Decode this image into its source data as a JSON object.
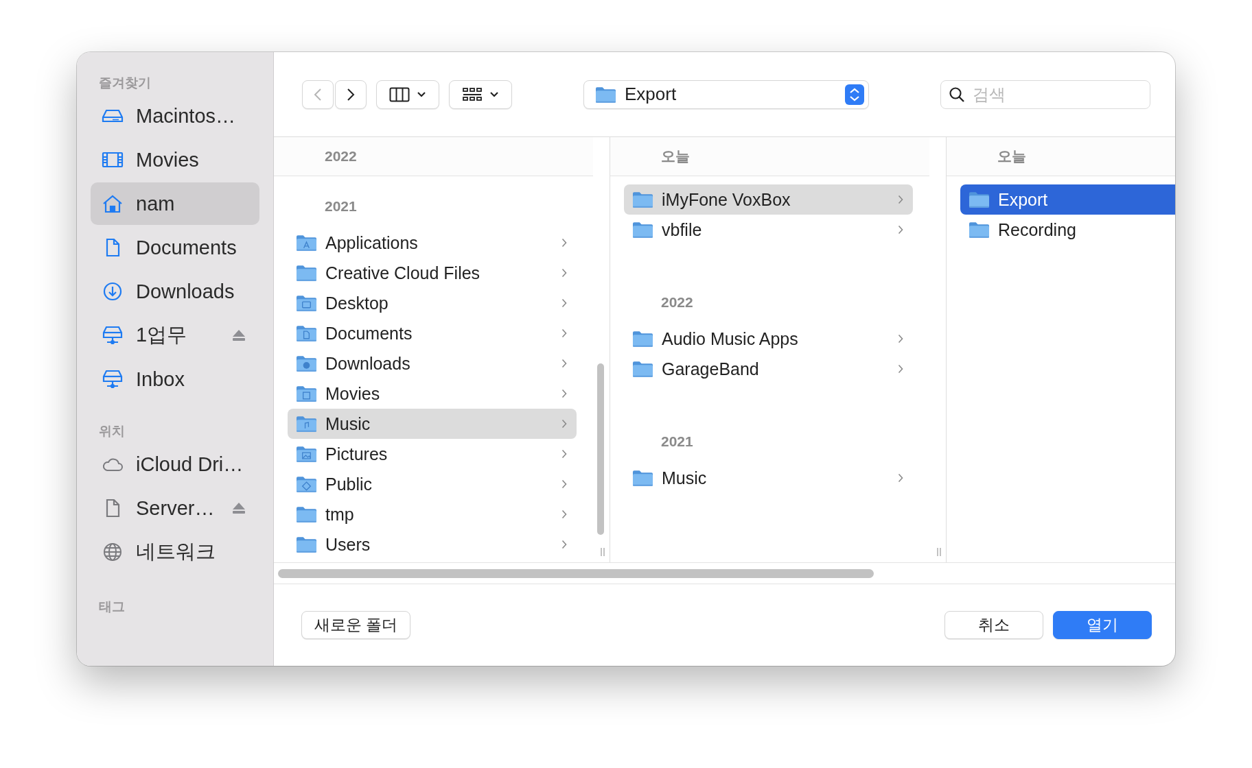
{
  "sidebar": {
    "sections": [
      {
        "title": "즐겨찾기",
        "kind": "favorites",
        "items": [
          {
            "label": "Macintos…",
            "kind": "drive",
            "selected": false,
            "eject": false
          },
          {
            "label": "Movies",
            "kind": "film",
            "selected": false,
            "eject": false
          },
          {
            "label": "nam",
            "kind": "home",
            "selected": true,
            "eject": false
          },
          {
            "label": "Documents",
            "kind": "document",
            "selected": false,
            "eject": false
          },
          {
            "label": "Downloads",
            "kind": "download",
            "selected": false,
            "eject": false
          },
          {
            "label": "1업무",
            "kind": "server",
            "selected": false,
            "eject": true
          },
          {
            "label": "Inbox",
            "kind": "server",
            "selected": false,
            "eject": false
          }
        ]
      },
      {
        "title": "위치",
        "kind": "locations",
        "items": [
          {
            "label": "iCloud Dri…",
            "kind": "cloud",
            "selected": false,
            "eject": false
          },
          {
            "label": "Server…",
            "kind": "document",
            "selected": false,
            "eject": true
          },
          {
            "label": "네트워크",
            "kind": "globe",
            "selected": false,
            "eject": false
          }
        ]
      },
      {
        "title": "태그",
        "kind": "tags"
      }
    ]
  },
  "toolbar": {
    "nav": [
      {
        "kind": "back",
        "disabled": true
      },
      {
        "kind": "forward",
        "disabled": false
      }
    ],
    "view_buttons": [
      {
        "kind": "columns"
      },
      {
        "kind": "grid"
      }
    ],
    "path_popup": "Export",
    "search": {
      "placeholder": "검색"
    }
  },
  "columns": [
    {
      "active": false,
      "groups": [
        {
          "heading": "2022"
        },
        {
          "heading": "2021",
          "items": [
            {
              "name": "Applications",
              "kind": "applications",
              "selected": false,
              "has_children": true
            },
            {
              "name": "Creative Cloud Files",
              "kind": "plain",
              "selected": false,
              "has_children": true
            },
            {
              "name": "Desktop",
              "kind": "desktop",
              "selected": false,
              "has_children": true
            },
            {
              "name": "Documents",
              "kind": "documents",
              "selected": false,
              "has_children": true
            },
            {
              "name": "Downloads",
              "kind": "downloads",
              "selected": false,
              "has_children": true
            },
            {
              "name": "Movies",
              "kind": "movies",
              "selected": false,
              "has_children": true
            },
            {
              "name": "Music",
              "kind": "music",
              "selected": true,
              "has_children": true
            },
            {
              "name": "Pictures",
              "kind": "pictures",
              "selected": false,
              "has_children": true
            },
            {
              "name": "Public",
              "kind": "public",
              "selected": false,
              "has_children": true
            },
            {
              "name": "tmp",
              "kind": "plain",
              "selected": false,
              "has_children": true
            },
            {
              "name": "Users",
              "kind": "plain",
              "selected": false,
              "has_children": true
            }
          ]
        }
      ]
    },
    {
      "active": false,
      "groups": [
        {
          "heading": "오늘",
          "items": [
            {
              "name": "iMyFone VoxBox",
              "kind": "plain",
              "selected": true,
              "has_children": true
            },
            {
              "name": "vbfile",
              "kind": "plain",
              "selected": false,
              "has_children": true
            }
          ]
        },
        {
          "heading": "2022",
          "items": [
            {
              "name": "Audio Music Apps",
              "kind": "plain",
              "selected": false,
              "has_children": true
            },
            {
              "name": "GarageBand",
              "kind": "plain",
              "selected": false,
              "has_children": true
            }
          ]
        },
        {
          "heading": "2021",
          "items": [
            {
              "name": "Music",
              "kind": "plain",
              "selected": false,
              "has_children": true
            }
          ]
        }
      ]
    },
    {
      "active": true,
      "groups": [
        {
          "heading": "오늘",
          "items": [
            {
              "name": "Export",
              "kind": "plain",
              "selected": true,
              "has_children": false
            },
            {
              "name": "Recording",
              "kind": "plain",
              "selected": false,
              "has_children": false
            }
          ]
        }
      ]
    }
  ],
  "buttons": [
    {
      "label": "새로운 폴더",
      "kind": "secondary"
    },
    {
      "label": "취소",
      "kind": "secondary"
    },
    {
      "label": "열기",
      "kind": "primary"
    }
  ]
}
